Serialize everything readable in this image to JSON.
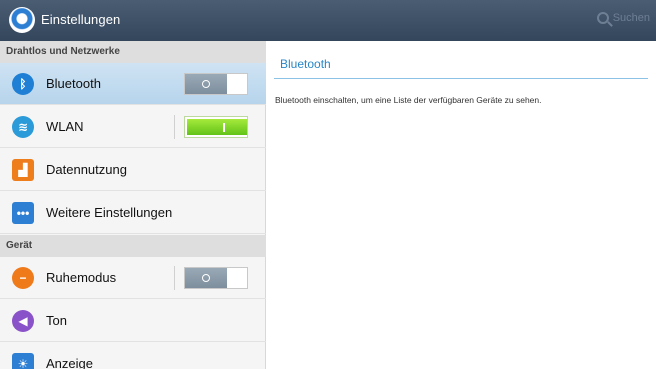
{
  "actionbar": {
    "title": "Einstellungen",
    "search_label": "Suchen",
    "app_icon": "settings-gear-icon",
    "search_icon": "search-icon"
  },
  "sections": [
    {
      "header": "Drahtlos und Netzwerke"
    },
    {
      "header": "Gerät"
    }
  ],
  "items": [
    {
      "label": "Bluetooth",
      "icon": "bluetooth-icon",
      "toggle": "off",
      "selected": true
    },
    {
      "label": "WLAN",
      "icon": "wifi-icon",
      "toggle": "on"
    },
    {
      "label": "Datennutzung",
      "icon": "data-usage-icon"
    },
    {
      "label": "Weitere Einstellungen",
      "icon": "more-icon"
    },
    {
      "label": "Ruhemodus",
      "icon": "blocking-mode-icon",
      "toggle": "off"
    },
    {
      "label": "Ton",
      "icon": "sound-icon"
    },
    {
      "label": "Anzeige",
      "icon": "display-icon"
    }
  ],
  "detail": {
    "title": "Bluetooth",
    "description": "Bluetooth einschalten, um eine Liste der verfügbaren Geräte zu sehen."
  },
  "colors": {
    "actionbar": "#3d4f65",
    "selected_row": "#c2dcf0",
    "accent": "#2a86c6",
    "toggle_on": "#7ad61f"
  }
}
